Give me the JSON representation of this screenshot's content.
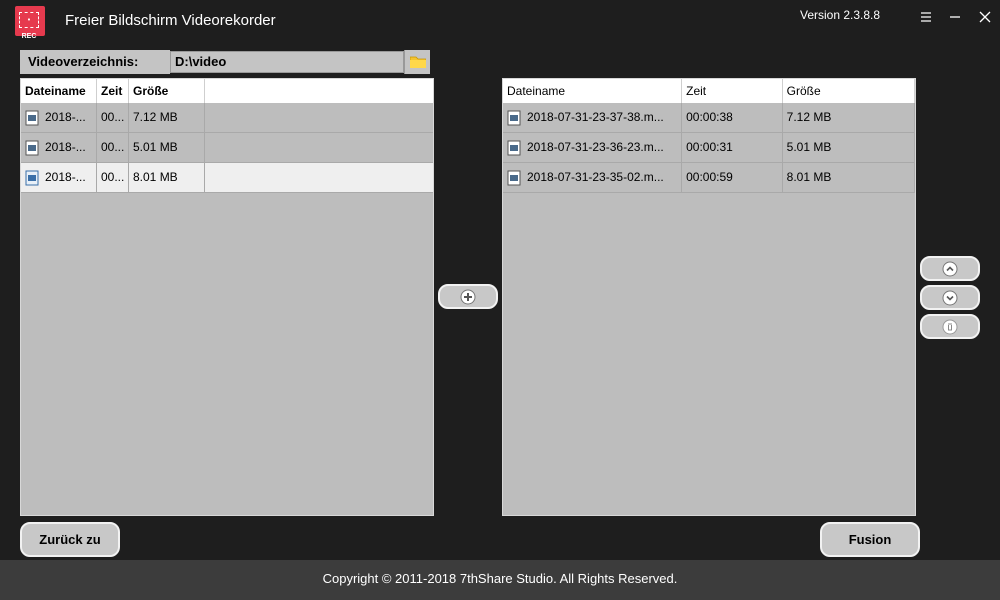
{
  "app": {
    "title": "Freier Bildschirm Videorekorder",
    "version": "Version 2.3.8.8",
    "logo_text": "• REC"
  },
  "directory": {
    "label": "Videoverzeichnis:",
    "value": "D:\\video"
  },
  "left_table": {
    "headers": [
      "Dateiname",
      "Zeit",
      "Größe"
    ],
    "rows": [
      {
        "name": "2018-...",
        "time": "00...",
        "size": "7.12 MB"
      },
      {
        "name": "2018-...",
        "time": "00...",
        "size": "5.01 MB"
      },
      {
        "name": "2018-...",
        "time": "00...",
        "size": "8.01 MB"
      }
    ]
  },
  "right_table": {
    "headers": [
      "Dateiname",
      "Zeit",
      "Größe"
    ],
    "rows": [
      {
        "name": "2018-07-31-23-37-38.m...",
        "time": "00:00:38",
        "size": "7.12 MB"
      },
      {
        "name": "2018-07-31-23-36-23.m...",
        "time": "00:00:31",
        "size": "5.01 MB"
      },
      {
        "name": "2018-07-31-23-35-02.m...",
        "time": "00:00:59",
        "size": "8.01 MB"
      }
    ]
  },
  "buttons": {
    "back": "Zurück zu",
    "fusion": "Fusion"
  },
  "footer": {
    "copyright": "Copyright © 2011-2018 7thShare Studio. All Rights Reserved."
  },
  "colors": {
    "background": "#1e1e1e",
    "logo": "#e63a4e",
    "panel": "#bdbdbd",
    "footer": "#3c3c3c"
  }
}
